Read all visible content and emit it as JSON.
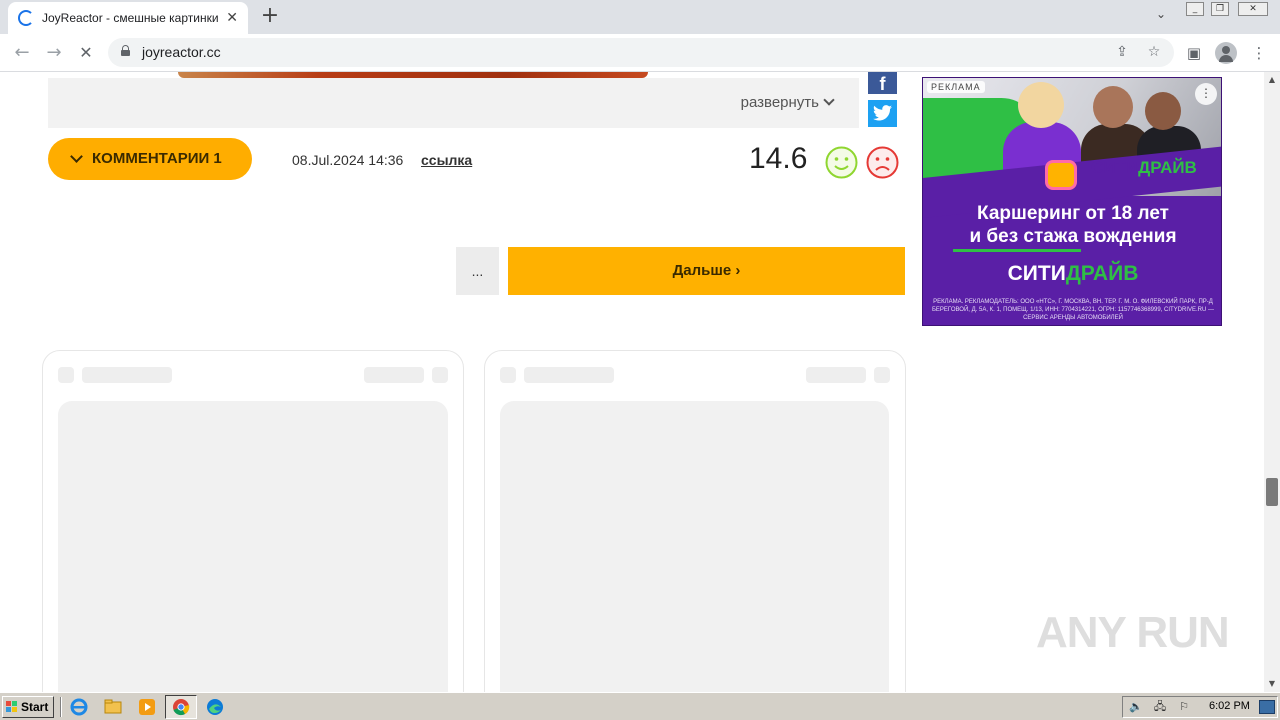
{
  "browser": {
    "tab": {
      "title": "JoyReactor - смешные картинки и"
    },
    "address": {
      "url": "joyreactor.cc"
    }
  },
  "post": {
    "expand_label": "развернуть",
    "comments_label": "КОММЕНТАРИИ 1",
    "date": "08.Jul.2024 14:36",
    "link_label": "ссылка",
    "rating": "14.6",
    "share": {
      "facebook_glyph": "f"
    }
  },
  "pagination": {
    "more_label": "...",
    "next_label": "Дальше ›"
  },
  "ad": {
    "label": "РЕКЛАМА",
    "brand_small_a": "СИТИ",
    "brand_small_b": "ДРАЙВ",
    "headline_line1": "Каршеринг от 18 лет",
    "headline_line2": "и без стажа вождения",
    "brand_big_a": "СИТИ",
    "brand_big_b": "ДРАЙВ",
    "legal": "РЕКЛАМА. РЕКЛАМОДАТЕЛЬ: ООО «НТС», Г. МОСКВА, ВН. ТЕР. Г. М. О. ФИЛЕВСКИЙ ПАРК, ПР-Д БЕРЕГОВОЙ, Д. 5А, К. 1, ПОМЕЩ. 1/13, ИНН: 7704314221, ОГРН: 1157746368999, CITYDRIVE.RU — СЕРВИС АРЕНДЫ АВТОМОБИЛЕЙ",
    "colors": {
      "purple": "#5a1fa6",
      "green": "#2fbf45"
    }
  },
  "watermark": "ANY RUN",
  "taskbar": {
    "start_label": "Start",
    "clock": "6:02 PM"
  },
  "colors": {
    "accent_orange": "#ffb100",
    "facebook": "#3b5998",
    "twitter": "#1da1f2",
    "vote_up": "#8fd630",
    "vote_down": "#e53935"
  },
  "icons": {
    "tab": "loading-spinner-icon",
    "back": "back-arrow-icon",
    "forward": "forward-arrow-icon",
    "stop": "close-icon",
    "lock": "lock-icon",
    "share": "share-icon",
    "bookmark": "star-icon",
    "side_panel": "side-panel-icon",
    "profile": "profile-icon",
    "menu": "kebab-menu-icon"
  }
}
